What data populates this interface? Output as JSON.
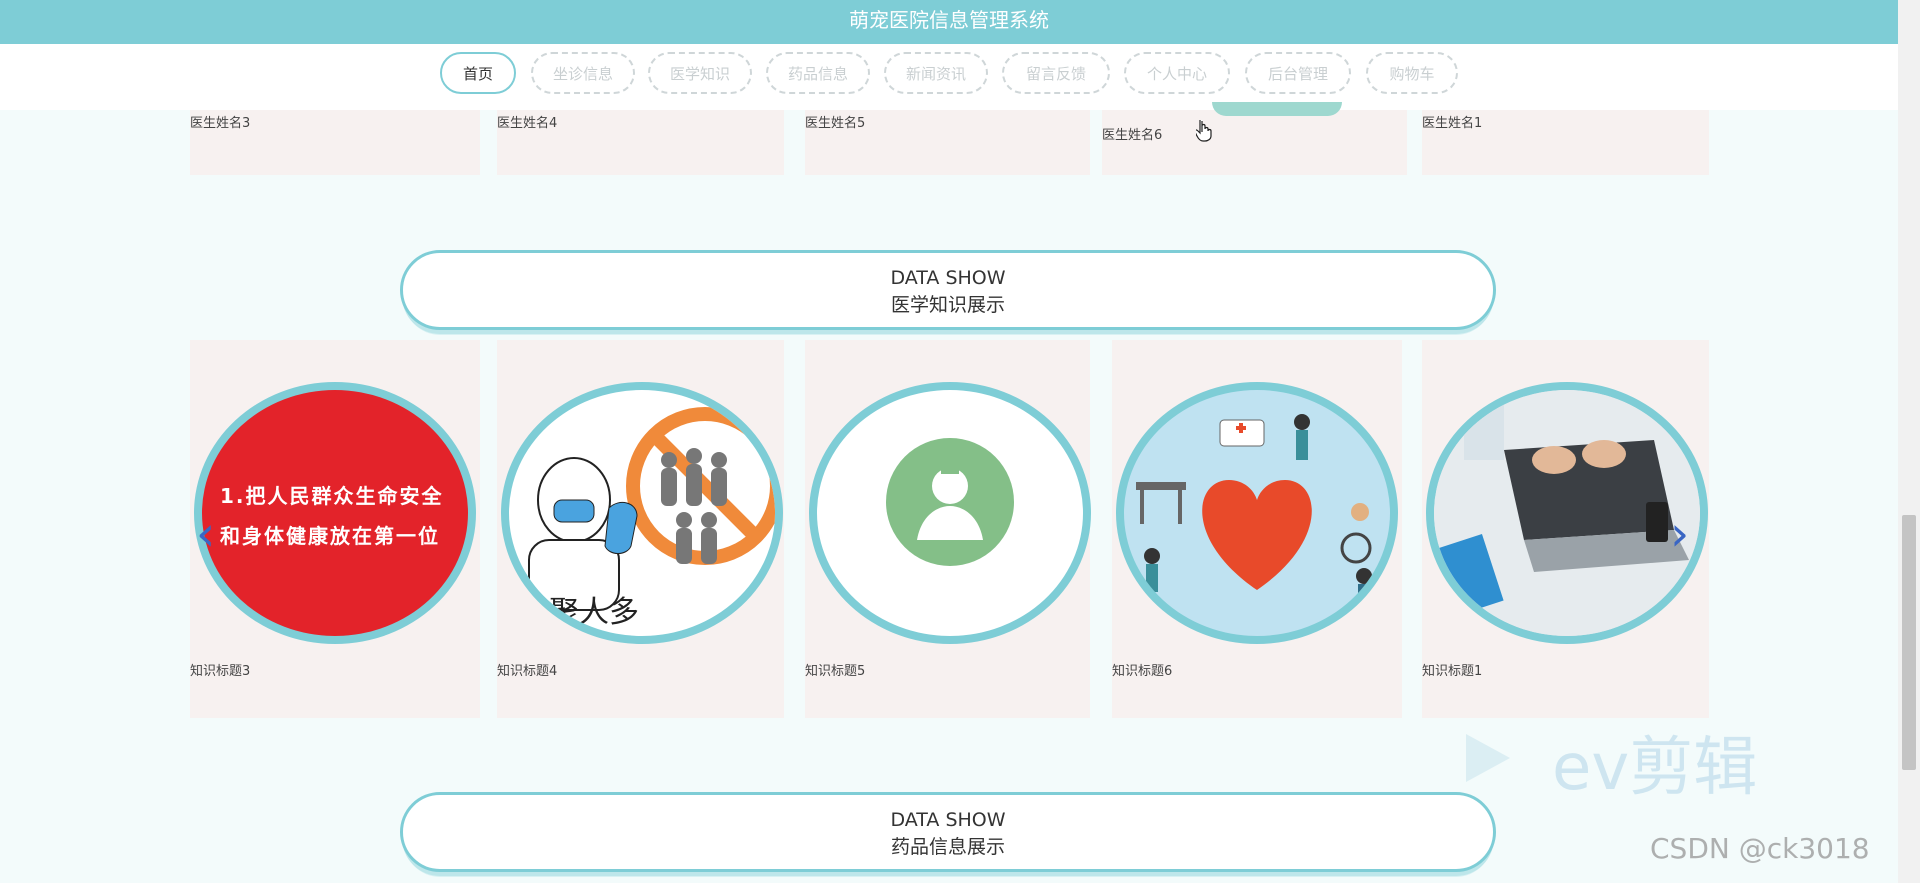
{
  "header": {
    "title": "萌宠医院信息管理系统"
  },
  "nav": {
    "items": [
      {
        "label": "首页",
        "active": true
      },
      {
        "label": "坐诊信息"
      },
      {
        "label": "医学知识"
      },
      {
        "label": "药品信息"
      },
      {
        "label": "新闻资讯"
      },
      {
        "label": "留言反馈"
      },
      {
        "label": "个人中心"
      },
      {
        "label": "后台管理"
      },
      {
        "label": "购物车"
      }
    ]
  },
  "doctors": {
    "names": [
      "医生姓名3",
      "医生姓名4",
      "医生姓名5",
      "医生姓名6",
      "医生姓名1"
    ]
  },
  "knowledge": {
    "heading_en": "DATA SHOW",
    "heading_cn": "医学知识展示",
    "items": [
      {
        "title": "知识标题3",
        "image_text": "1.把人民群众生命安全 和身体健康放在第一位"
      },
      {
        "title": "知识标题4",
        "image_text": "聚人多"
      },
      {
        "title": "知识标题5",
        "icon": "doctor-icon"
      },
      {
        "title": "知识标题6",
        "icon": "heart-icon"
      },
      {
        "title": "知识标题1",
        "icon": "laptop-photo"
      }
    ],
    "prev_icon": "chevron-left-icon",
    "next_icon": "chevron-right-icon"
  },
  "medicine": {
    "heading_en": "DATA SHOW",
    "heading_cn": "药品信息展示"
  },
  "watermarks": {
    "ev": "ev剪辑",
    "csdn": "CSDN @ck3018"
  },
  "colors": {
    "accent": "#7ecdd6",
    "arrow": "#3a66c4"
  }
}
